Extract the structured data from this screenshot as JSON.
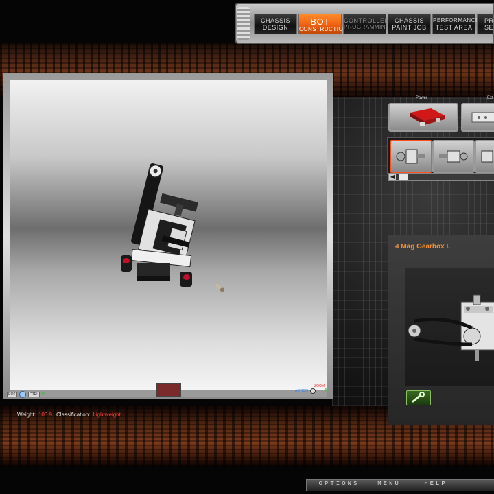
{
  "nav": {
    "items": [
      {
        "line1": "CHASSIS",
        "line2": "DESIGN"
      },
      {
        "line1": "BOT",
        "line2": "CONSTRUCTION"
      },
      {
        "line1": "CONTROLLER",
        "line2": "PROGRAMMING"
      },
      {
        "line1": "CHASSIS",
        "line2": "PAINT JOB"
      },
      {
        "line1": "PERFORMANCE",
        "line2": "TEST AREA"
      },
      {
        "line1": "PR",
        "line2": "SE"
      }
    ],
    "active_index": 1
  },
  "viewport": {
    "toolbar": {
      "rot_label": "ROT",
      "ctrl_label": "CTRL",
      "zoom_label": "ZOOM",
      "action_label": "ACTION"
    }
  },
  "stats": {
    "weight_label": "Weight:",
    "weight_value": "103.9",
    "class_label": "Classification:",
    "class_value": "Lightweight"
  },
  "parts": {
    "categories": [
      "Power",
      "Ext"
    ],
    "selected_part": "4 Mag Gearbox L"
  },
  "bottom_menu": {
    "options": "OPTIONS",
    "menu": "MENU",
    "help": "HELP"
  },
  "colors": {
    "accent": "#f06010",
    "warning": "#ff4030",
    "title": "#f09030"
  }
}
